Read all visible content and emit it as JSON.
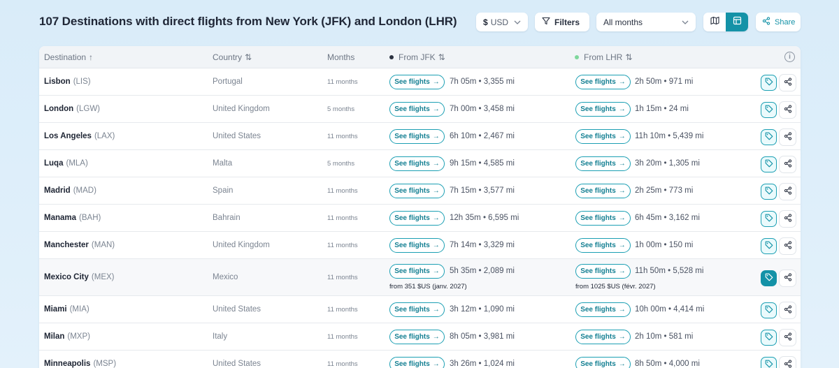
{
  "header": {
    "title": "107 Destinations with direct flights from New York (JFK) and London (LHR)",
    "currency_symbol": "$",
    "currency_code": "USD",
    "filters_label": "Filters",
    "months_value": "All months",
    "share_label": "Share"
  },
  "table": {
    "columns": {
      "destination": "Destination",
      "country": "Country",
      "months": "Months",
      "from_jfk": "From JFK",
      "from_lhr": "From LHR"
    },
    "sort_asc_glyph": "↑",
    "sort_both_glyph": "⇅",
    "jfk_dot_color": "#2b3240",
    "lhr_dot_color": "#7ed79c",
    "see_flights_label": "See flights",
    "arrow_glyph": "→",
    "rows": [
      {
        "city": "Lisbon",
        "code": "(LIS)",
        "country": "Portugal",
        "months": "11 months",
        "jfk": "7h 05m • 3,355 mi",
        "lhr": "2h 50m • 971 mi"
      },
      {
        "city": "London",
        "code": "(LGW)",
        "country": "United Kingdom",
        "months": "5 months",
        "jfk": "7h 00m • 3,458 mi",
        "lhr": "1h 15m • 24 mi"
      },
      {
        "city": "Los Angeles",
        "code": "(LAX)",
        "country": "United States",
        "months": "11 months",
        "jfk": "6h 10m • 2,467 mi",
        "lhr": "11h 10m • 5,439 mi"
      },
      {
        "city": "Luqa",
        "code": "(MLA)",
        "country": "Malta",
        "months": "5 months",
        "jfk": "9h 15m • 4,585 mi",
        "lhr": "3h 20m • 1,305 mi"
      },
      {
        "city": "Madrid",
        "code": "(MAD)",
        "country": "Spain",
        "months": "11 months",
        "jfk": "7h 15m • 3,577 mi",
        "lhr": "2h 25m • 773 mi"
      },
      {
        "city": "Manama",
        "code": "(BAH)",
        "country": "Bahrain",
        "months": "11 months",
        "jfk": "12h 35m • 6,595 mi",
        "lhr": "6h 45m • 3,162 mi"
      },
      {
        "city": "Manchester",
        "code": "(MAN)",
        "country": "United Kingdom",
        "months": "11 months",
        "jfk": "7h 14m • 3,329 mi",
        "lhr": "1h 00m • 150 mi"
      },
      {
        "city": "Mexico City",
        "code": "(MEX)",
        "country": "Mexico",
        "months": "11 months",
        "jfk": "5h 35m • 2,089 mi",
        "lhr": "11h 50m • 5,528 mi",
        "jfk_price": "from 351 $US (janv. 2027)",
        "lhr_price": "from 1025 $US (févr. 2027)"
      },
      {
        "city": "Miami",
        "code": "(MIA)",
        "country": "United States",
        "months": "11 months",
        "jfk": "3h 12m • 1,090 mi",
        "lhr": "10h 00m • 4,414 mi"
      },
      {
        "city": "Milan",
        "code": "(MXP)",
        "country": "Italy",
        "months": "11 months",
        "jfk": "8h 05m • 3,981 mi",
        "lhr": "2h 10m • 581 mi"
      },
      {
        "city": "Minneapolis",
        "code": "(MSP)",
        "country": "United States",
        "months": "11 months",
        "jfk": "3h 26m • 1,024 mi",
        "lhr": "8h 50m • 4,000 mi"
      }
    ]
  },
  "colors": {
    "accent": "#1492a7",
    "background": "#dcedf9"
  }
}
